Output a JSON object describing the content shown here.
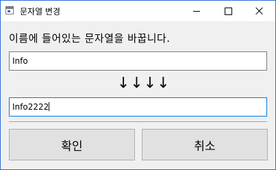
{
  "window": {
    "title": "문자열 변경",
    "controls": {
      "minimize_icon": "minimize-icon",
      "maximize_icon": "maximize-icon",
      "close_icon": "close-icon"
    }
  },
  "main": {
    "instruction": "이름에 들어있는 문자열을 바꿉니다.",
    "find_field": {
      "value": "Info"
    },
    "arrows": "↓↓↓↓",
    "replace_field": {
      "value": "Info2222"
    }
  },
  "buttons": {
    "ok_label": "확인",
    "cancel_label": "취소"
  },
  "colors": {
    "window_border": "#2b6bd3",
    "focus_border": "#0078d7",
    "button_face": "#e1e1e1"
  }
}
